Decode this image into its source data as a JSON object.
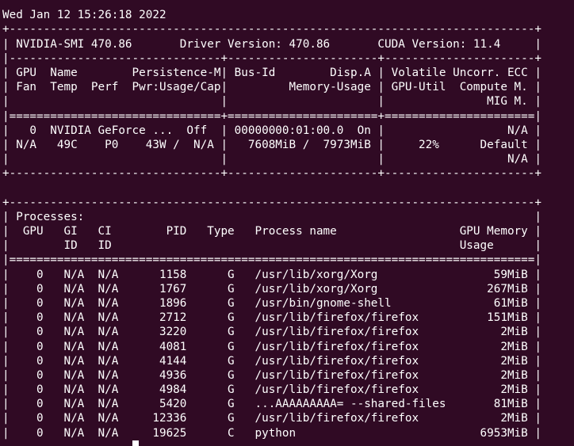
{
  "terminal": {
    "lines": [
      "",
      "Wed Jan 12 15:26:18 2022",
      "+-----------------------------------------------------------------------------+",
      "| NVIDIA-SMI 470.86       Driver Version: 470.86       CUDA Version: 11.4     |",
      "|-------------------------------+----------------------+----------------------+",
      "| GPU  Name        Persistence-M| Bus-Id        Disp.A | Volatile Uncorr. ECC |",
      "| Fan  Temp  Perf  Pwr:Usage/Cap|         Memory-Usage | GPU-Util  Compute M. |",
      "|                               |                      |               MIG M. |",
      "|===============================+======================+======================|",
      "|   0  NVIDIA GeForce ...  Off  | 00000000:01:00.0  On |                  N/A |",
      "| N/A   49C    P0    43W /  N/A |   7608MiB /  7973MiB |     22%      Default |",
      "|                               |                      |                  N/A |",
      "+-------------------------------+----------------------+----------------------+",
      "",
      "+-----------------------------------------------------------------------------+",
      "| Processes:                                                                  |",
      "|  GPU   GI   CI        PID   Type   Process name                  GPU Memory |",
      "|        ID   ID                                                   Usage      |",
      "|=============================================================================|",
      "|    0   N/A  N/A      1158      G   /usr/lib/xorg/Xorg                 59MiB |",
      "|    0   N/A  N/A      1767      G   /usr/lib/xorg/Xorg                267MiB |",
      "|    0   N/A  N/A      1896      G   /usr/bin/gnome-shell               61MiB |",
      "|    0   N/A  N/A      2712      G   /usr/lib/firefox/firefox          151MiB |",
      "|    0   N/A  N/A      3220      G   /usr/lib/firefox/firefox            2MiB |",
      "|    0   N/A  N/A      4081      G   /usr/lib/firefox/firefox            2MiB |",
      "|    0   N/A  N/A      4144      G   /usr/lib/firefox/firefox            2MiB |",
      "|    0   N/A  N/A      4936      G   /usr/lib/firefox/firefox            2MiB |",
      "|    0   N/A  N/A      4984      G   /usr/lib/firefox/firefox            2MiB |",
      "|    0   N/A  N/A      5420      G   ...AAAAAAAAA= --shared-files       81MiB |",
      "|    0   N/A  N/A     12336      G   /usr/lib/firefox/firefox            2MiB |",
      "|    0   N/A  N/A     19625      C   python                           6953MiB |"
    ],
    "background_color": "#300a24",
    "text_color": "#ffffff"
  }
}
